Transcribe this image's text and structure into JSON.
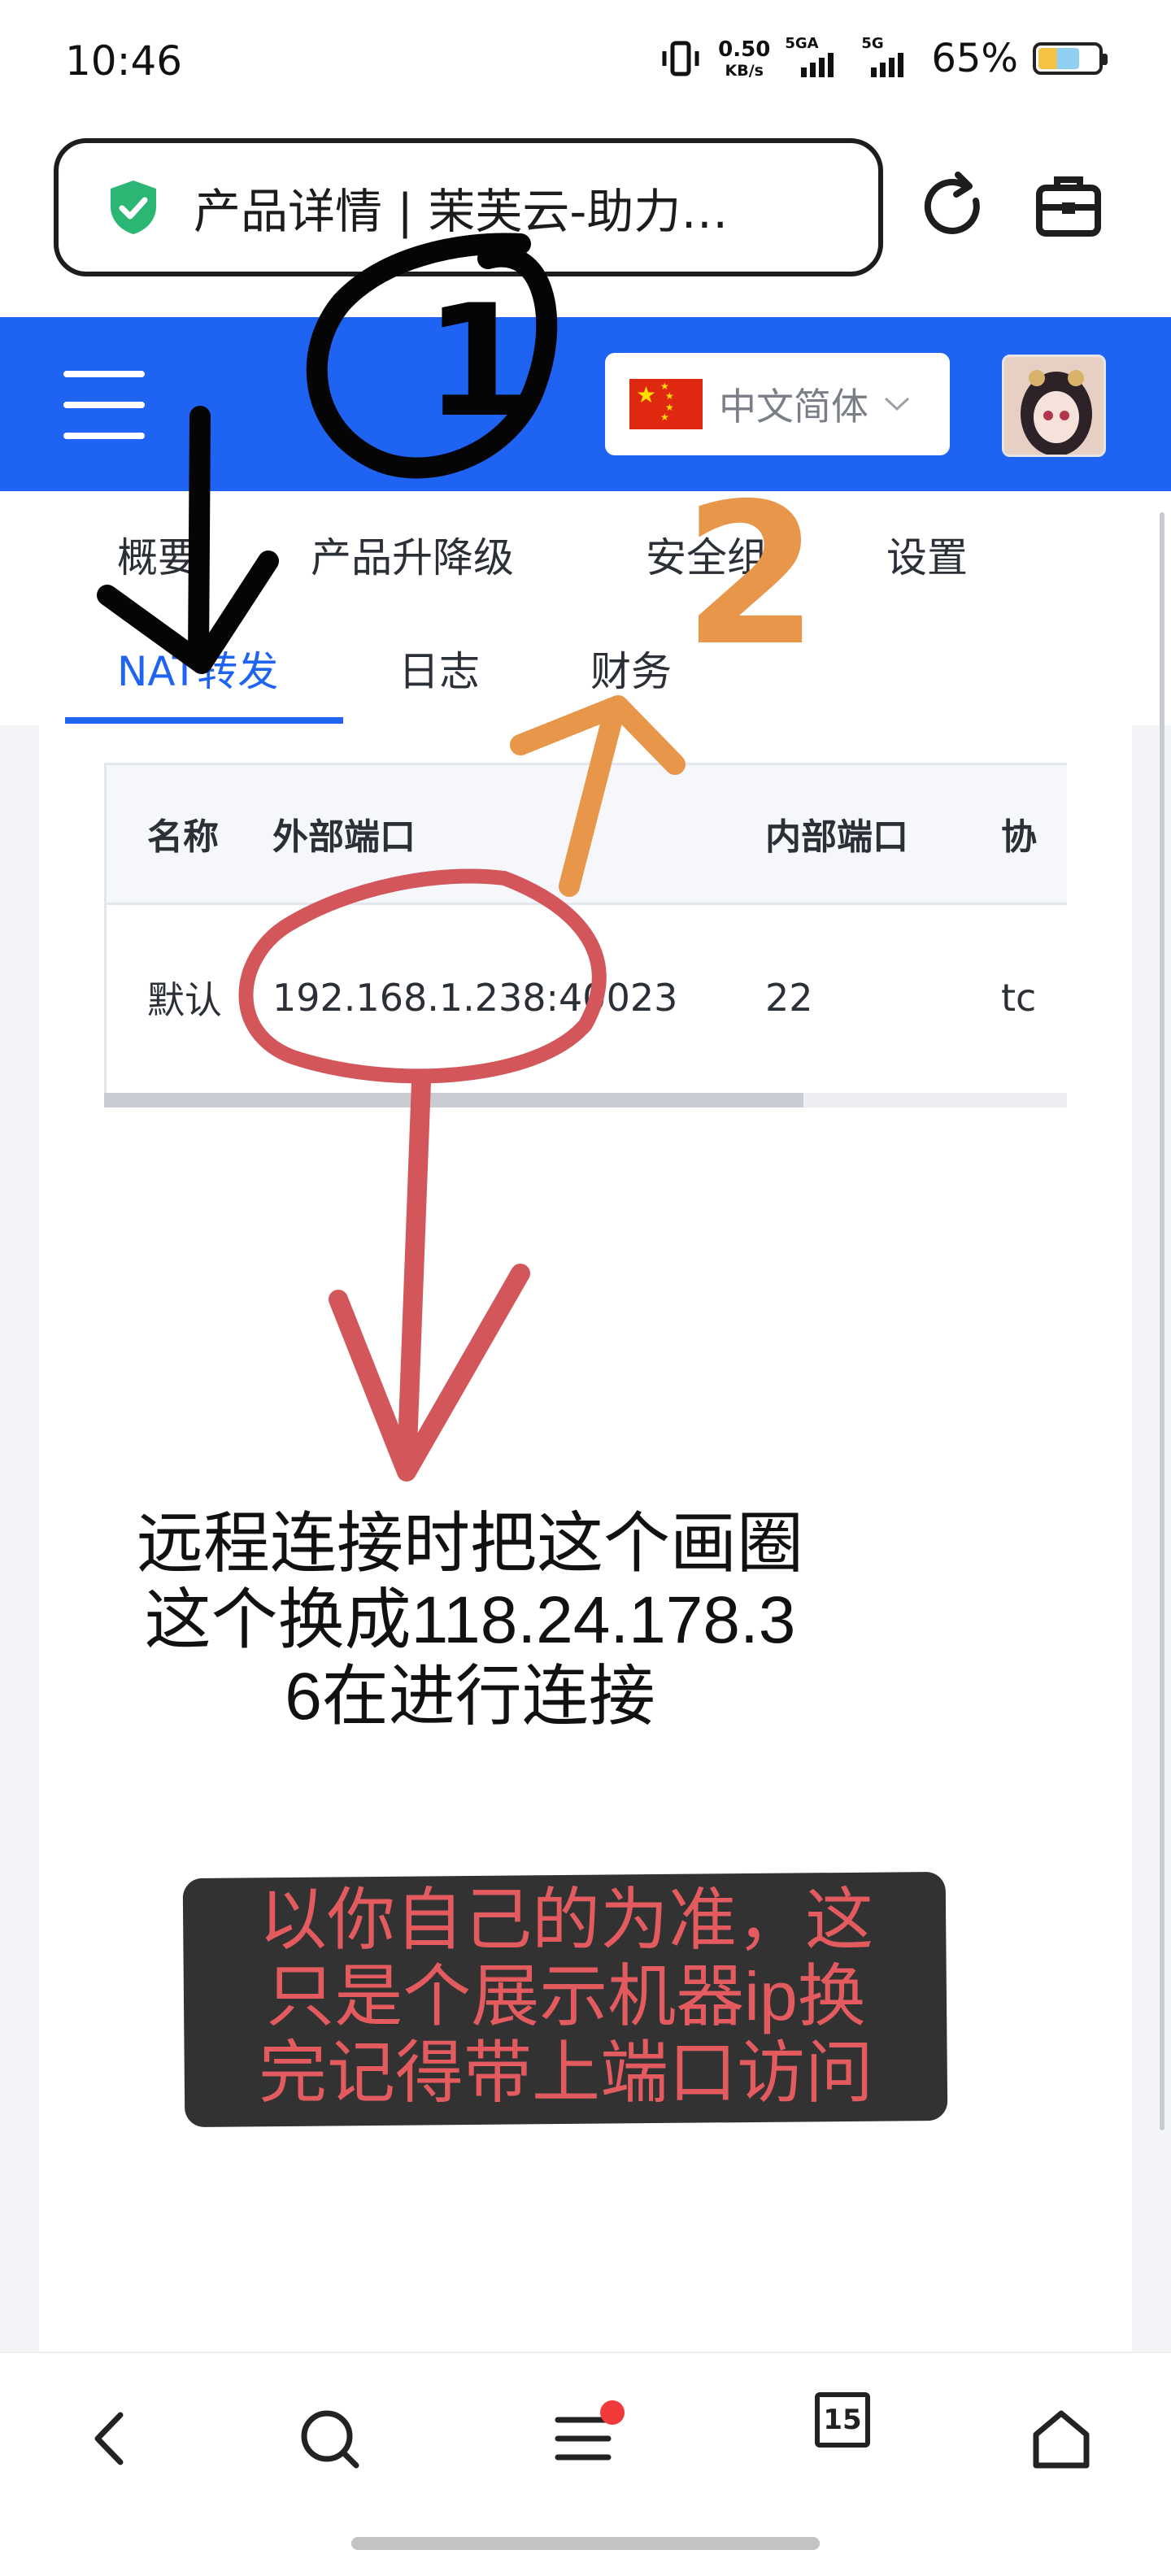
{
  "status_bar": {
    "time": "10:46",
    "net_speed_value": "0.50",
    "net_speed_unit": "KB/s",
    "sim1_label": "5GA",
    "sim2_label": "5G",
    "battery_percent": "65%"
  },
  "browser": {
    "url_title": "产品详情 | 茉芙云-助力…"
  },
  "header": {
    "language": "中文简体"
  },
  "tabs": [
    {
      "label": "概要"
    },
    {
      "label": "产品升降级"
    },
    {
      "label": "安全组"
    },
    {
      "label": "设置"
    },
    {
      "label": "NAT转发",
      "active": true
    },
    {
      "label": "日志"
    },
    {
      "label": "财务"
    }
  ],
  "table": {
    "columns": [
      "名称",
      "外部端口",
      "内部端口",
      "协"
    ],
    "rows": [
      {
        "name": "默认",
        "external": "192.168.1.238:40023",
        "internal": "22",
        "protocol": "tc"
      }
    ]
  },
  "annotations": {
    "circle_1": "1",
    "circle_2": "2",
    "note_black": [
      "远程连接时把这个画圈",
      "这个换成118.24.178.3",
      "6在进行连接"
    ],
    "note_red": [
      "以你自己的为准，这",
      "只是个展示机器ip换",
      "完记得带上端口访问"
    ]
  },
  "bottom_nav": {
    "tab_count": "15"
  },
  "colors": {
    "brand_blue": "#1f63f2",
    "annotation_red": "#d2565a",
    "annotation_orange": "#e8964a"
  }
}
